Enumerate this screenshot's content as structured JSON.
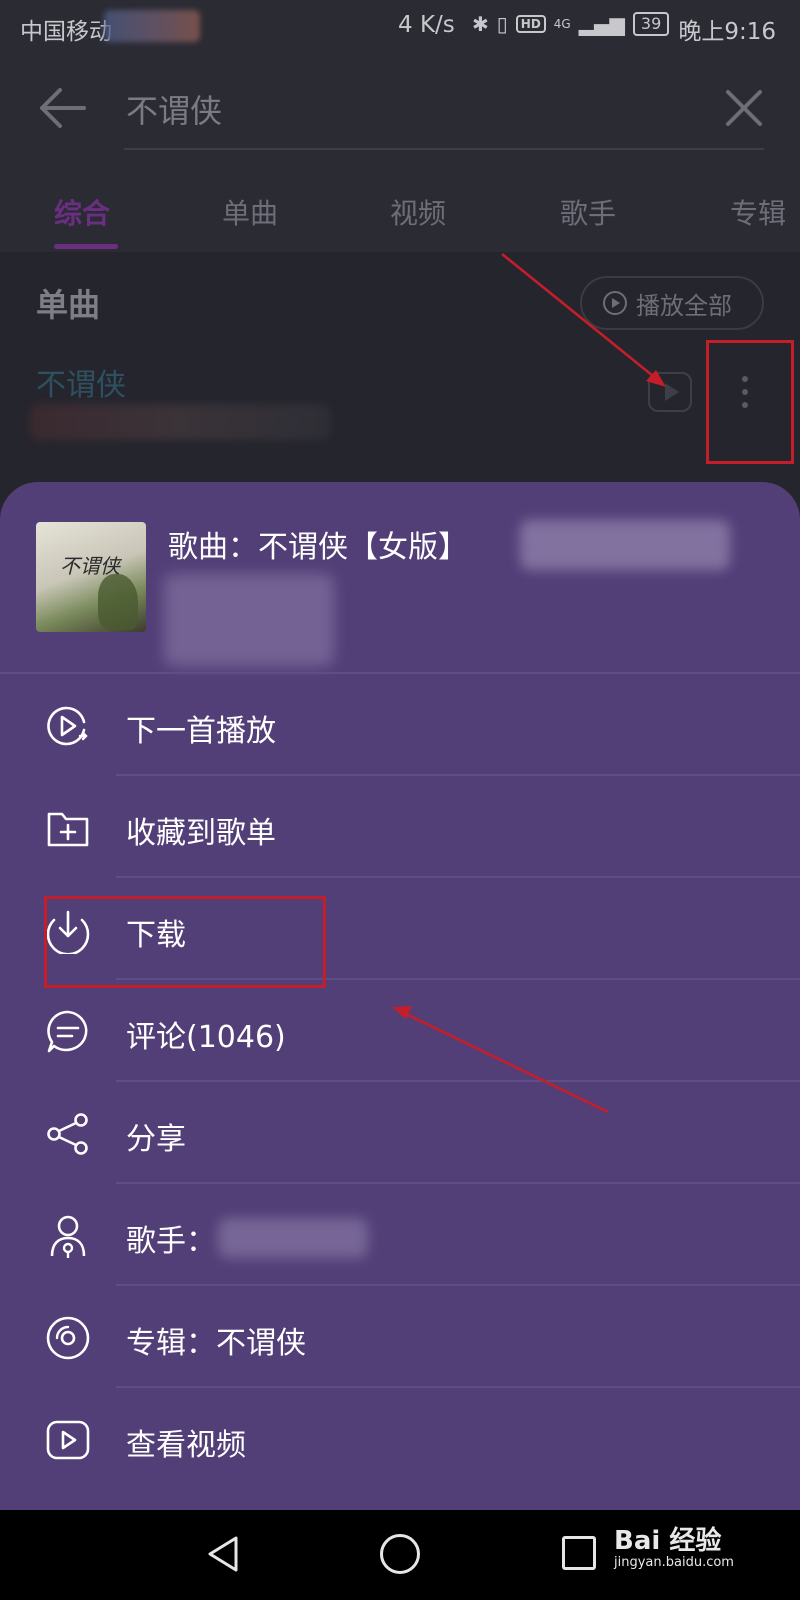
{
  "status_bar": {
    "carrier": "中国移动",
    "net_speed": "4 K/s",
    "hd": "HD",
    "signal": "4G",
    "battery": "39",
    "time": "晚上9:16"
  },
  "search": {
    "query": "不谓侠"
  },
  "tabs": [
    {
      "label": "综合",
      "active": true
    },
    {
      "label": "单曲",
      "active": false
    },
    {
      "label": "视频",
      "active": false
    },
    {
      "label": "歌手",
      "active": false
    },
    {
      "label": "专辑",
      "active": false
    }
  ],
  "section": {
    "title": "单曲",
    "play_all": "播放全部",
    "song_title": "不谓侠"
  },
  "sheet": {
    "song_label": "歌曲：不谓侠【女版】",
    "album_art_text": "不谓侠",
    "menu": [
      {
        "label": "下一首播放",
        "icon": "play-next-icon"
      },
      {
        "label": "收藏到歌单",
        "icon": "add-to-folder-icon"
      },
      {
        "label": "下载",
        "icon": "download-icon"
      },
      {
        "label": "评论(1046)",
        "icon": "comment-icon"
      },
      {
        "label": "分享",
        "icon": "share-icon"
      },
      {
        "label": "歌手：",
        "icon": "singer-icon"
      },
      {
        "label": "专辑：不谓侠",
        "icon": "album-icon"
      },
      {
        "label": "查看视频",
        "icon": "video-icon"
      }
    ]
  },
  "watermark": {
    "main": "Bai 经验",
    "sub": "jingyan.baidu.com"
  },
  "colors": {
    "sheet_bg": "#523f77",
    "accent": "#6a2f80",
    "annotation_red": "#c41e2a"
  }
}
